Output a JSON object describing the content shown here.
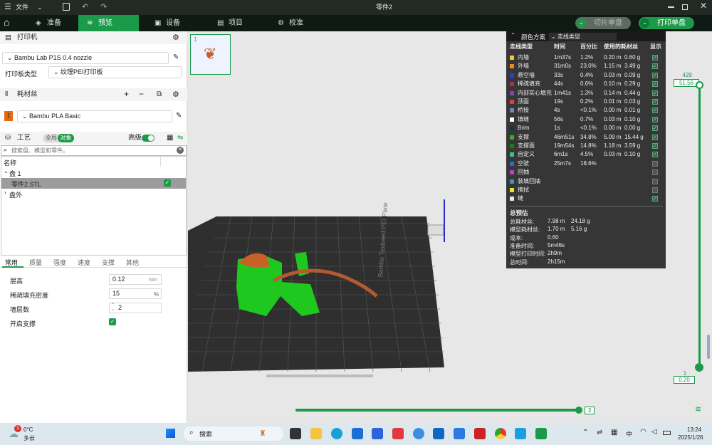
{
  "titlebar": {
    "menu": "文件",
    "title": "零件2"
  },
  "nav": {
    "tabs": [
      "准备",
      "预览",
      "设备",
      "项目",
      "校准"
    ],
    "active": "预览",
    "slice_btn": "切片单盘",
    "print_btn": "打印单盘"
  },
  "printer": {
    "section": "打印机",
    "model": "Bambu Lab P1S 0.4 nozzle",
    "plate_label": "打印板类型",
    "plate_value": "纹理PEI打印板"
  },
  "filament": {
    "section": "耗材丝",
    "index": "1",
    "name": "Bambu PLA Basic"
  },
  "process": {
    "section": "工艺",
    "toggle_all": "全局",
    "toggle_obj": "对象",
    "advanced": "高级",
    "search_placeholder": "搜索盘、模型和零件。"
  },
  "tree": {
    "header": "名称",
    "plate": "盘 1",
    "part": "零件2.STL",
    "outside": "盘外"
  },
  "settings_tabs": [
    "常用",
    "质量",
    "强度",
    "速度",
    "支撑",
    "其他"
  ],
  "settings": {
    "layer_height": {
      "label": "层高",
      "value": "0.12",
      "unit": "mm"
    },
    "infill": {
      "label": "稀疏填充密度",
      "value": "15",
      "unit": "%"
    },
    "walls": {
      "label": "墙层数",
      "value": "2"
    },
    "support": {
      "label": "开启支撑"
    }
  },
  "legend": {
    "header": "颜色方案",
    "scheme": "走线类型",
    "columns": [
      "走线类型",
      "时间",
      "百分比",
      "使用的耗材丝",
      "显示"
    ],
    "rows": [
      {
        "name": "内墙",
        "time": "1m37s",
        "pct": "1.2%",
        "len": "0.20 m",
        "wt": "0.60 g",
        "color": "#f5c542",
        "on": true
      },
      {
        "name": "外墙",
        "time": "31m0s",
        "pct": "23.0%",
        "len": "1.15 m",
        "wt": "3.49 g",
        "color": "#f08a20",
        "on": true
      },
      {
        "name": "悬空墙",
        "time": "33s",
        "pct": "0.4%",
        "len": "0.03 m",
        "wt": "0.09 g",
        "color": "#3040c0",
        "on": true
      },
      {
        "name": "稀疏填充",
        "time": "44s",
        "pct": "0.6%",
        "len": "0.10 m",
        "wt": "0.29 g",
        "color": "#b03050",
        "on": true
      },
      {
        "name": "内部实心填充",
        "time": "1m41s",
        "pct": "1.3%",
        "len": "0.14 m",
        "wt": "0.44 g",
        "color": "#8a40b0",
        "on": true
      },
      {
        "name": "顶面",
        "time": "19s",
        "pct": "0.2%",
        "len": "0.01 m",
        "wt": "0.03 g",
        "color": "#e04040",
        "on": true
      },
      {
        "name": "桥接",
        "time": "4s",
        "pct": "<0.1%",
        "len": "0.00 m",
        "wt": "0.01 g",
        "color": "#6a8ab0",
        "on": true
      },
      {
        "name": "填缝",
        "time": "56s",
        "pct": "0.7%",
        "len": "0.03 m",
        "wt": "0.10 g",
        "color": "#ffffff",
        "on": true
      },
      {
        "name": "Brim",
        "time": "1s",
        "pct": "<0.1%",
        "len": "0.00 m",
        "wt": "0.00 g",
        "color": "#103a40",
        "on": true
      },
      {
        "name": "支撑",
        "time": "46m51s",
        "pct": "34.8%",
        "len": "5.09 m",
        "wt": "15.44 g",
        "color": "#30b030",
        "on": true
      },
      {
        "name": "支撑面",
        "time": "19m54s",
        "pct": "14.8%",
        "len": "1.18 m",
        "wt": "3.59 g",
        "color": "#1c7a1c",
        "on": true
      },
      {
        "name": "自定义",
        "time": "6m1s",
        "pct": "4.5%",
        "len": "0.03 m",
        "wt": "0.10 g",
        "color": "#40c090",
        "on": true
      },
      {
        "name": "空驶",
        "time": "25m7s",
        "pct": "18.6%",
        "len": "",
        "wt": "",
        "color": "#2a6ad0",
        "on": false
      },
      {
        "name": "回抽",
        "time": "",
        "pct": "",
        "len": "",
        "wt": "",
        "color": "#c040c0",
        "on": false
      },
      {
        "name": "装填回抽",
        "time": "",
        "pct": "",
        "len": "",
        "wt": "",
        "color": "#4090c0",
        "on": false
      },
      {
        "name": "擦拭",
        "time": "",
        "pct": "",
        "len": "",
        "wt": "",
        "color": "#e8e820",
        "on": false
      },
      {
        "name": "缝",
        "time": "",
        "pct": "",
        "len": "",
        "wt": "",
        "color": "#e8e8e8",
        "on": true
      }
    ],
    "summary_title": "总预估",
    "summary": [
      {
        "k": "总耗材丝:",
        "v1": "7.98 m",
        "v2": "24.18 g"
      },
      {
        "k": "模型耗材丝:",
        "v1": "1.70 m",
        "v2": "5.16 g"
      },
      {
        "k": "成本:",
        "v1": "0.60",
        "v2": ""
      },
      {
        "k": "准备时间:",
        "v1": "5m46s",
        "v2": ""
      },
      {
        "k": "模型打印时间:",
        "v1": "2h9m",
        "v2": ""
      },
      {
        "k": "总时间:",
        "v1": "2h15m",
        "v2": ""
      }
    ]
  },
  "viewport": {
    "plate_label": "Bambu Textured PEI Plate",
    "thumb_index": "1",
    "layer_top": "429",
    "height_top": "51.56",
    "layer_bottom": "1",
    "height_bottom": "0.20",
    "move_value": "3"
  },
  "taskbar": {
    "weather_temp": "0°C",
    "weather_desc": "多云",
    "weather_badge": "1",
    "search": "搜索",
    "ime": "中",
    "time": "13:24",
    "date": "2025/1/26"
  }
}
